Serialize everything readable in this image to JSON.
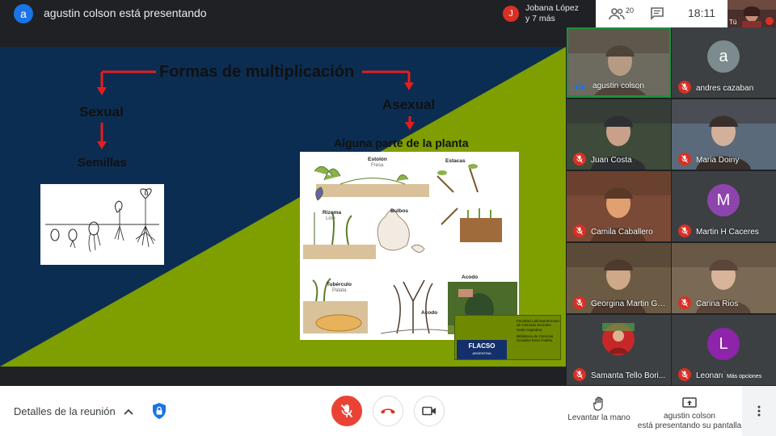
{
  "topbar": {
    "presenter_initial": "a",
    "presenter_title": "agustin colson está presentando",
    "joined_initial": "J",
    "joined_line1": "Jobana López",
    "joined_line2": "y 7 más",
    "people_count": "20",
    "time": "18:11",
    "self_label": "Tú"
  },
  "slide": {
    "title": "Formas de multiplicación",
    "sexual": "Sexual",
    "seeds": "Semillas",
    "asexual": "Asexual",
    "plant_part": "Alguna parte de la planta",
    "labels": {
      "estolon": "Estolón",
      "fresa": "Fresa",
      "estacas": "Estacas",
      "rizoma": "Rizoma",
      "lirio": "Lirio",
      "bulbos": "Bulbos",
      "tuberculo": "Tubérculo",
      "patata": "Patata",
      "acodo1": "Acodo",
      "acodo2": "Acodo"
    },
    "flacso_logo": "FLACSO",
    "flacso_sub": "ARGENTINA",
    "flacso_text1": "Facultad Latinoamericana de Ciencias Sociales Sede Argentina",
    "flacso_text2": "Biblioteca de Ciencias Sociales Enzo Faletto"
  },
  "participants": [
    {
      "name": "agustin colson",
      "type": "video",
      "speaking": true
    },
    {
      "name": "andres cazaban",
      "type": "avatar",
      "initial": "a",
      "color": "#7c8b8d"
    },
    {
      "name": "Juan Costa",
      "type": "video"
    },
    {
      "name": "Maria Doiny",
      "type": "video"
    },
    {
      "name": "Camila Caballero",
      "type": "video"
    },
    {
      "name": "Martin H Caceres",
      "type": "avatar",
      "initial": "M",
      "color": "#8e44ad"
    },
    {
      "name": "Georgina Martin Ga...",
      "type": "video"
    },
    {
      "name": "Carina Rios",
      "type": "video"
    },
    {
      "name": "Samanta Tello Bori...",
      "type": "photo"
    },
    {
      "name": "Leonardo...",
      "type": "avatar",
      "initial": "L",
      "color": "#8e24aa"
    }
  ],
  "more_options_tooltip": "Más opciones",
  "bottombar": {
    "details_label": "Detalles de la reunión",
    "raise_hand_label": "Levantar la mano",
    "presenting_line1": "agustin colson",
    "presenting_line2": "está presentando su pantalla"
  },
  "colors": {
    "slide_blue": "#0b2d52",
    "slide_green": "#7f9e00",
    "danger": "#ea4335",
    "primary": "#1a73e8"
  }
}
